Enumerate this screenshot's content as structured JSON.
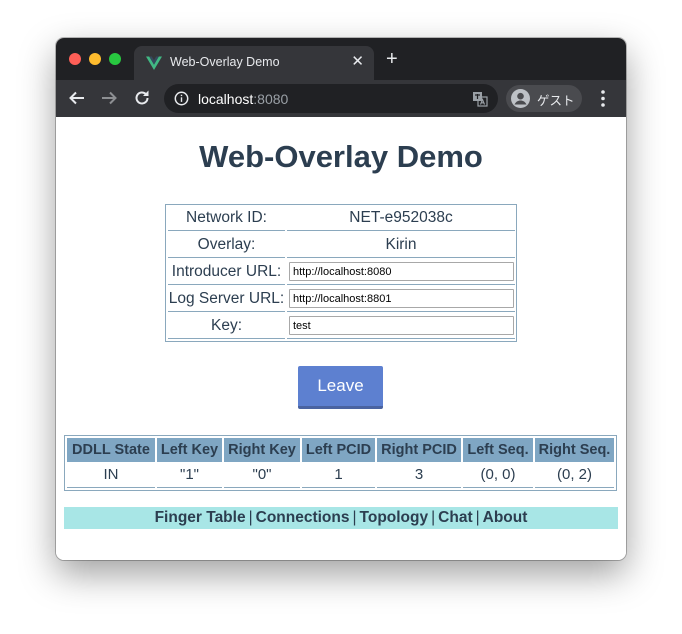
{
  "browser": {
    "tab_title": "Web-Overlay Demo",
    "url_host": "localhost",
    "url_port": ":8080",
    "profile_label": "ゲスト",
    "new_tab_glyph": "+",
    "close_glyph": "✕"
  },
  "page": {
    "title": "Web-Overlay Demo"
  },
  "info": {
    "network_id_label": "Network ID:",
    "network_id_value": "NET-e952038c",
    "overlay_label": "Overlay:",
    "overlay_value": "Kirin",
    "introducer_label": "Introducer URL:",
    "introducer_value": "http://localhost:8080",
    "log_server_label": "Log Server URL:",
    "log_server_value": "http://localhost:8801",
    "key_label": "Key:",
    "key_value": "test"
  },
  "leave_button": "Leave",
  "ddll": {
    "headers": [
      "DDLL State",
      "Left Key",
      "Right Key",
      "Left PCID",
      "Right PCID",
      "Left Seq.",
      "Right Seq."
    ],
    "row": [
      "IN",
      "\"1\"",
      "\"0\"",
      "1",
      "3",
      "(0, 0)",
      "(0, 2)"
    ]
  },
  "nav": {
    "links": [
      "Finger Table",
      "Connections",
      "Topology",
      "Chat",
      "About"
    ],
    "separator": "|"
  },
  "colors": {
    "heading": "#2c3e50",
    "button": "#5d80d0",
    "table_header": "#7fa6c3",
    "nav_background": "#a8e6e6",
    "tab_bar": "#202124",
    "toolbar": "#35363a"
  },
  "icons": [
    "vue-logo-icon",
    "close-icon",
    "plus-icon",
    "back-arrow-icon",
    "forward-arrow-icon",
    "reload-icon",
    "info-icon",
    "translate-icon",
    "profile-avatar-icon",
    "menu-icon"
  ]
}
